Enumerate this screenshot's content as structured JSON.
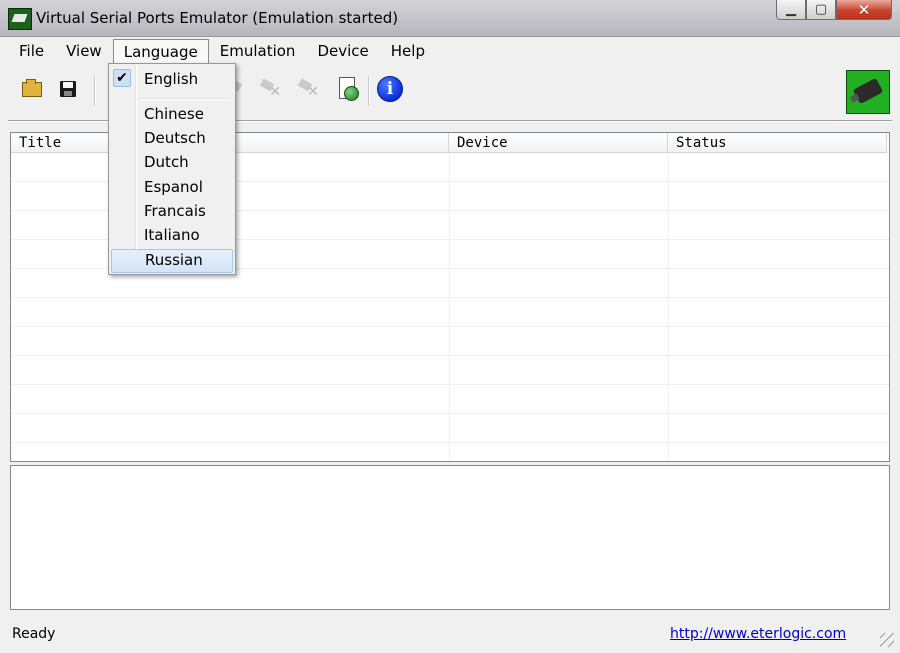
{
  "window": {
    "title": "Virtual Serial Ports Emulator (Emulation started)"
  },
  "caption_buttons": {
    "minimize": "▁",
    "maximize": "▢",
    "close": "✕"
  },
  "menubar": [
    {
      "label": "File"
    },
    {
      "label": "View"
    },
    {
      "label": "Language"
    },
    {
      "label": "Emulation"
    },
    {
      "label": "Device"
    },
    {
      "label": "Help"
    }
  ],
  "toolbar": {
    "icons": [
      "open-folder-icon",
      "save-icon",
      "plug-remove-icon",
      "plug-remove-all-icon",
      "document-globe-icon",
      "info-icon",
      "brand-logo-icon"
    ],
    "info_glyph": "i"
  },
  "language_menu": {
    "selected": "English",
    "check_glyph": "✔",
    "items": [
      {
        "label": "English"
      },
      {
        "label": "Chinese"
      },
      {
        "label": "Deutsch"
      },
      {
        "label": "Dutch"
      },
      {
        "label": "Espanol"
      },
      {
        "label": "Francais"
      },
      {
        "label": "Italiano"
      },
      {
        "label": "Russian"
      }
    ],
    "hovered": "Russian"
  },
  "list": {
    "columns": [
      {
        "label": "Title"
      },
      {
        "label": "Device"
      },
      {
        "label": "Status"
      }
    ]
  },
  "statusbar": {
    "text": "Ready",
    "link": "http://www.eterlogic.com"
  },
  "colors": {
    "link": "#0000cc",
    "close_button": "#c9452f",
    "brand_green": "#22b022"
  }
}
